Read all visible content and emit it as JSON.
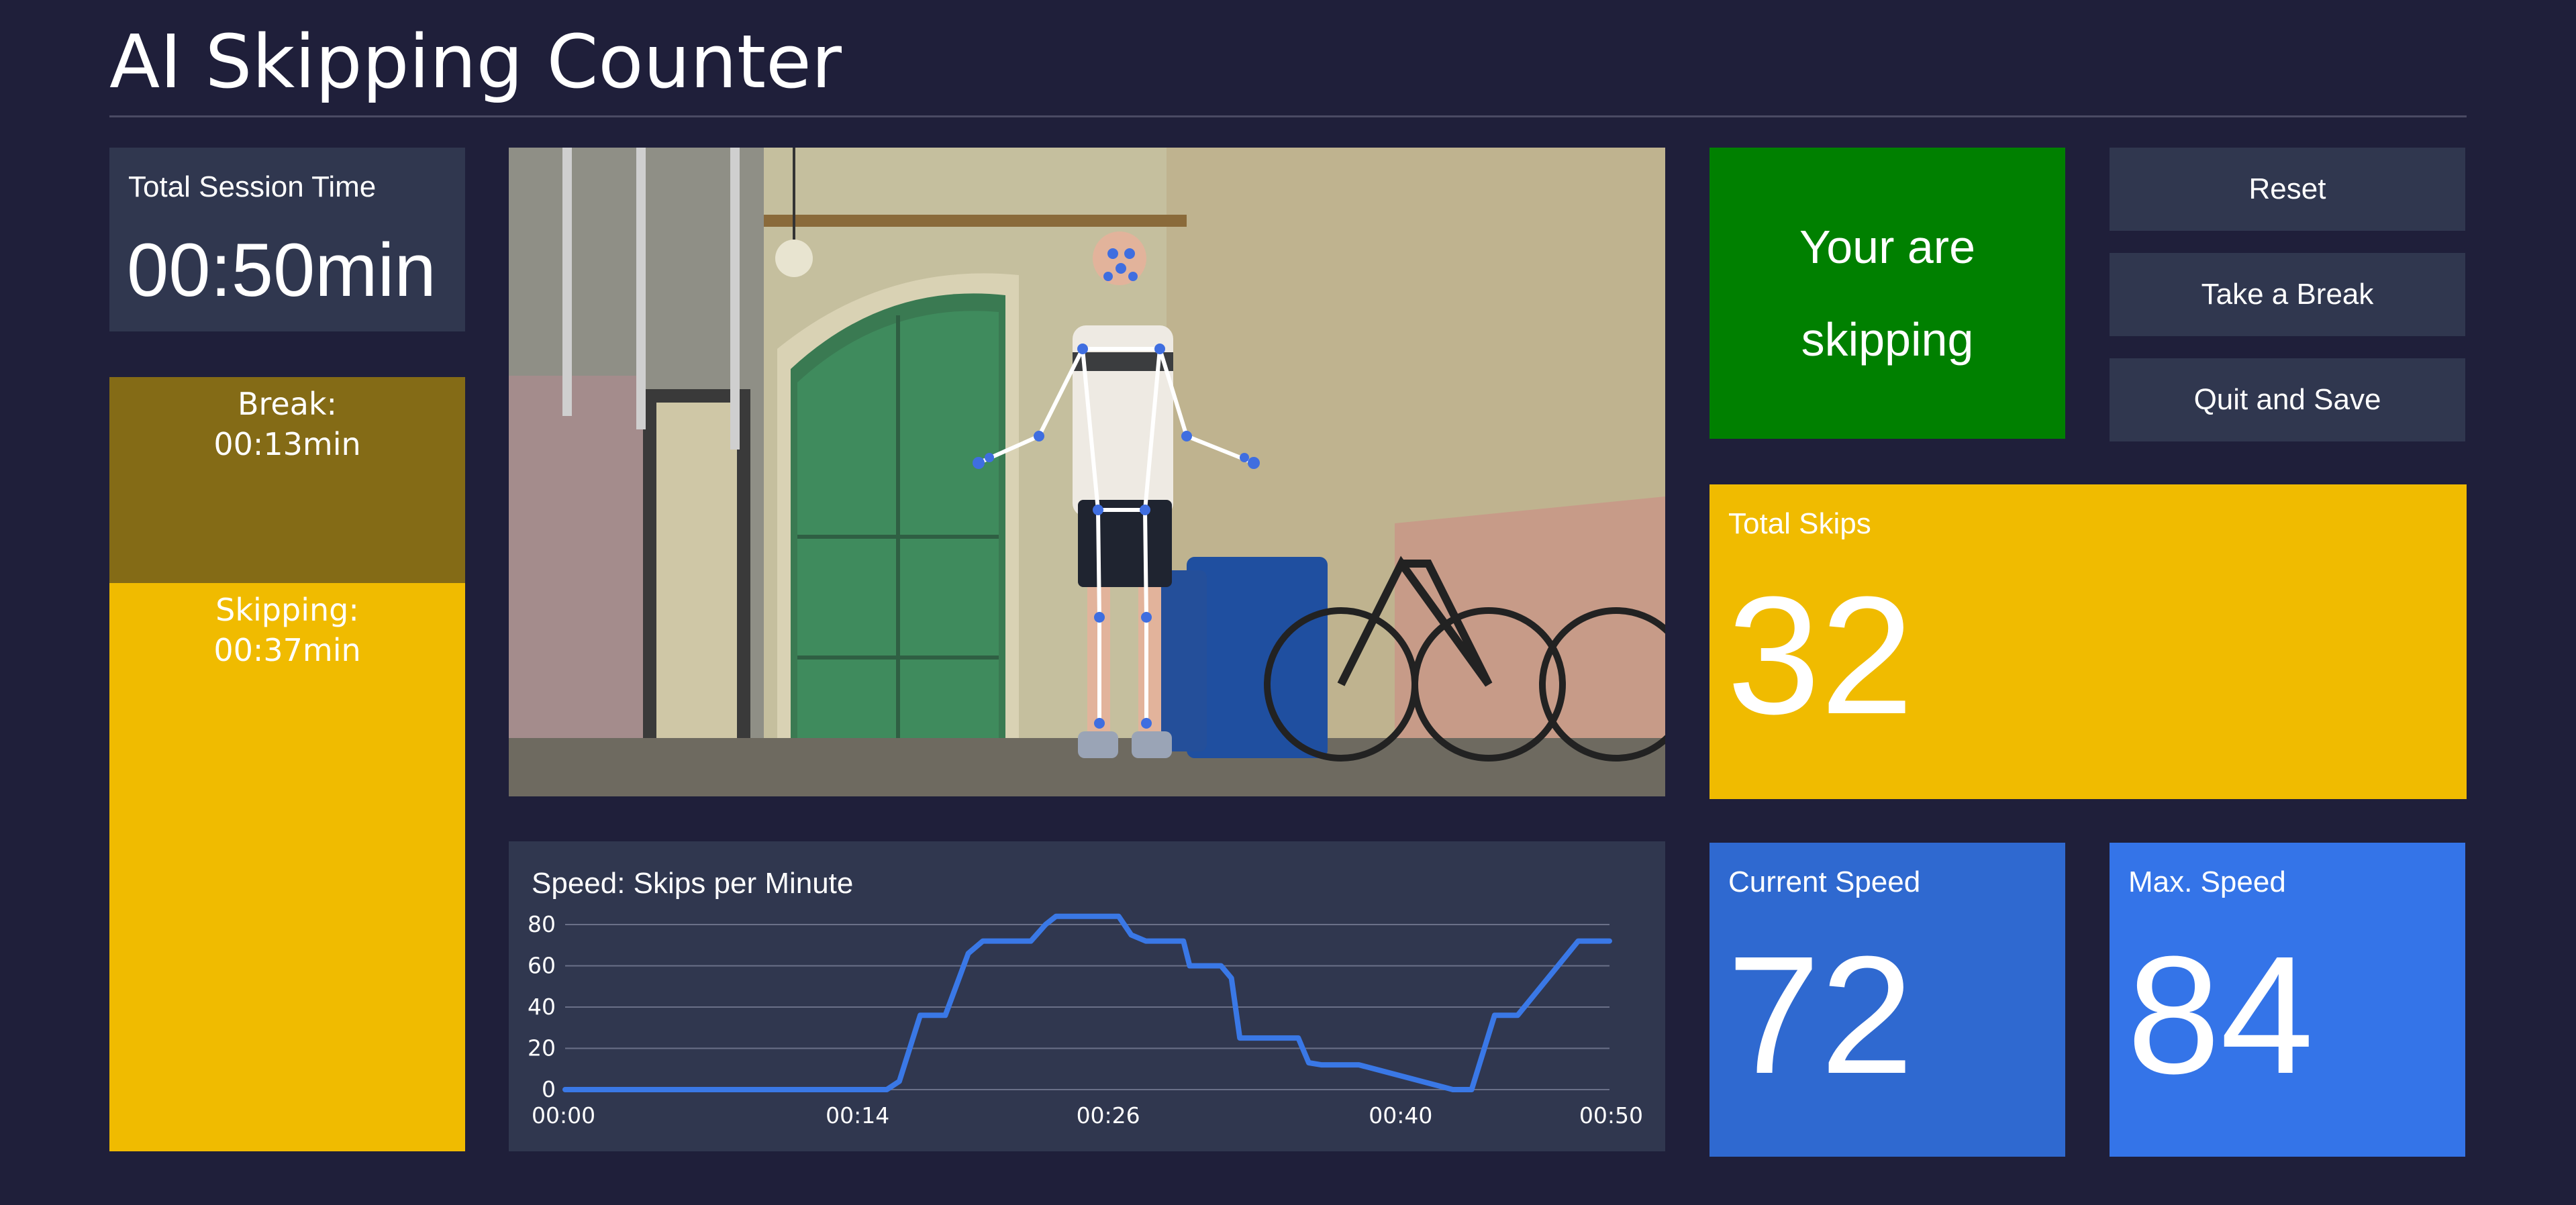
{
  "app": {
    "title": "AI Skipping Counter"
  },
  "session": {
    "label": "Total Session Time",
    "value": "00:50min"
  },
  "breakdown": {
    "break_label": "Break:",
    "break_value": "00:13min",
    "skipping_label": "Skipping:",
    "skipping_value": "00:37min"
  },
  "status": {
    "text": "Your are skipping"
  },
  "buttons": {
    "reset": "Reset",
    "take_break": "Take a Break",
    "quit_save": "Quit and Save"
  },
  "total_skips": {
    "label": "Total Skips",
    "value": "32"
  },
  "current_speed": {
    "label": "Current Speed",
    "value": "72"
  },
  "max_speed": {
    "label": "Max. Speed",
    "value": "84"
  },
  "colors": {
    "background": "#1f1f3a",
    "tile": "#30374f",
    "break": "#846b16",
    "skipping": "#f0bb00",
    "status_active": "#008000",
    "current_speed": "#2f69d0",
    "max_speed": "#3474e8",
    "line": "#3a78e6"
  },
  "chart_data": {
    "type": "line",
    "title": "Speed: Skips per Minute",
    "xlabel": "",
    "ylabel": "",
    "x_ticks": [
      "00:00",
      "00:14",
      "00:26",
      "00:40",
      "00:50"
    ],
    "x_tick_seconds": [
      0,
      14,
      26,
      40,
      50
    ],
    "y_ticks": [
      0,
      20,
      40,
      60,
      80
    ],
    "xlim": [
      0,
      50
    ],
    "ylim": [
      0,
      80
    ],
    "grid": true,
    "series": [
      {
        "x": [
          0,
          15.4,
          16.0,
          17.0,
          17.6,
          18.2,
          19.3,
          20.0,
          20.4,
          22.3,
          23.0,
          23.5,
          25.0,
          26.5,
          27.1,
          27.8,
          29.0,
          29.6,
          29.9,
          31.4,
          31.9,
          32.3,
          35.1,
          35.6,
          36.2,
          38.0,
          42.5,
          43.0,
          43.4,
          44.5,
          45.0,
          45.6,
          48.5,
          50
        ],
        "y": [
          0,
          0,
          4,
          36,
          36,
          36,
          66,
          72,
          72,
          72,
          80,
          84,
          84,
          84,
          75,
          72,
          72,
          72,
          60,
          60,
          54,
          25,
          25,
          13,
          12,
          12,
          0,
          0,
          0,
          36,
          36,
          36,
          72,
          72
        ]
      }
    ],
    "video_overlay": "pose-keypoints"
  }
}
